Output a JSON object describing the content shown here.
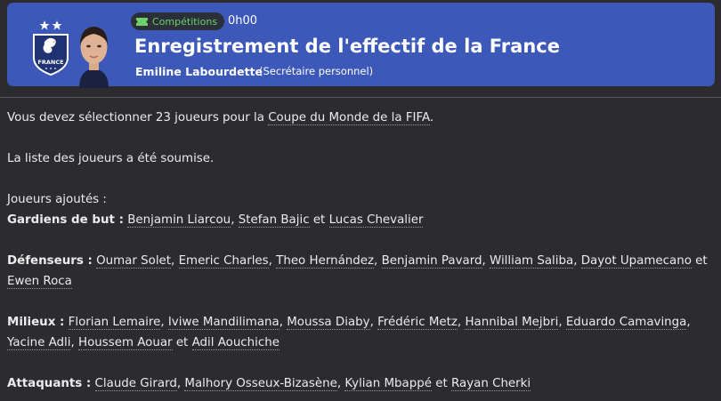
{
  "header": {
    "category_label": "Compétitions",
    "category_icon": "ticket-icon",
    "time": "0h00",
    "title": "Enregistrement de l'effectif de la France",
    "sender_name": "Emiline Labourdette",
    "sender_role": "(Secrétaire personnel)",
    "crest_text": "FRANCE",
    "accent_color": "#3c58b8",
    "tag_color": "#6fd06a"
  },
  "message": {
    "intro_prefix": "Vous devez sélectionner 23 joueurs pour la ",
    "competition": "Coupe du Monde de la FIFA",
    "intro_suffix": ".",
    "submitted": "La liste des joueurs a été soumise.",
    "added_heading": "Joueurs ajoutés :",
    "and": " et ",
    "sep": ", ",
    "groups": [
      {
        "label": "Gardiens de but :",
        "players": [
          "Benjamin Liarcou",
          "Stefan Bajic",
          "Lucas Chevalier"
        ]
      },
      {
        "label": "Défenseurs :",
        "players": [
          "Oumar Solet",
          "Emeric Charles",
          "Theo Hernández",
          "Benjamin Pavard",
          "William Saliba",
          "Dayot Upamecano",
          "Ewen Roca"
        ]
      },
      {
        "label": "Milieux :",
        "players": [
          "Florian Lemaire",
          "Iviwe Mandilimana",
          "Moussa Diaby",
          "Frédéric Metz",
          "Hannibal Mejbri",
          "Eduardo Camavinga",
          "Yacine Adli",
          "Houssem Aouar",
          "Adil Aouchiche"
        ]
      },
      {
        "label": "Attaquants :",
        "players": [
          "Claude Girard",
          "Malhory Osseux-Bizasène",
          "Kylian Mbappé",
          "Rayan Cherki"
        ]
      }
    ]
  }
}
